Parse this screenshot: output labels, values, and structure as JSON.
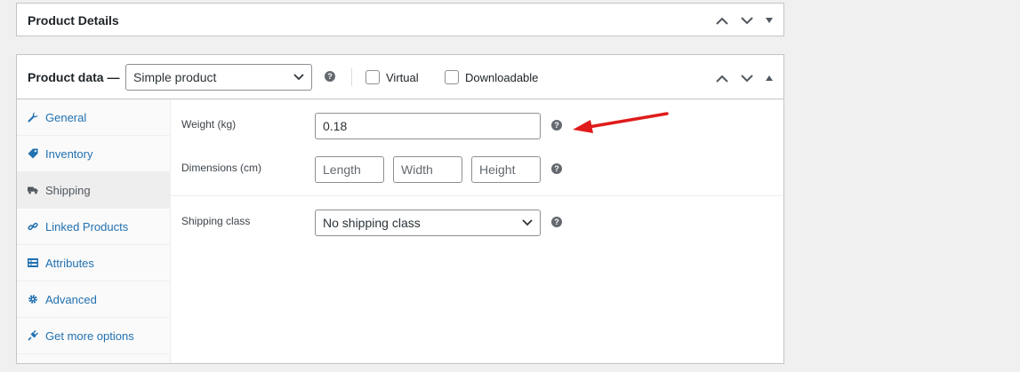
{
  "product_details": {
    "title": "Product Details"
  },
  "product_data": {
    "title": "Product data —",
    "product_type": "Simple product",
    "virtual_label": "Virtual",
    "downloadable_label": "Downloadable",
    "help_glyph": "?"
  },
  "tabs": [
    {
      "label": "General",
      "icon": "wrench-icon"
    },
    {
      "label": "Inventory",
      "icon": "tag-icon"
    },
    {
      "label": "Shipping",
      "icon": "truck-icon",
      "active": true
    },
    {
      "label": "Linked Products",
      "icon": "link-icon"
    },
    {
      "label": "Attributes",
      "icon": "attributes-icon"
    },
    {
      "label": "Advanced",
      "icon": "gear-icon"
    },
    {
      "label": "Get more options",
      "icon": "plugin-icon"
    }
  ],
  "shipping": {
    "weight_label": "Weight (kg)",
    "weight_value": "0.18",
    "dimensions_label": "Dimensions (cm)",
    "length_placeholder": "Length",
    "width_placeholder": "Width",
    "height_placeholder": "Height",
    "class_label": "Shipping class",
    "class_value": "No shipping class"
  },
  "colors": {
    "link": "#2271b1",
    "annotation_arrow": "#e01b1b"
  }
}
